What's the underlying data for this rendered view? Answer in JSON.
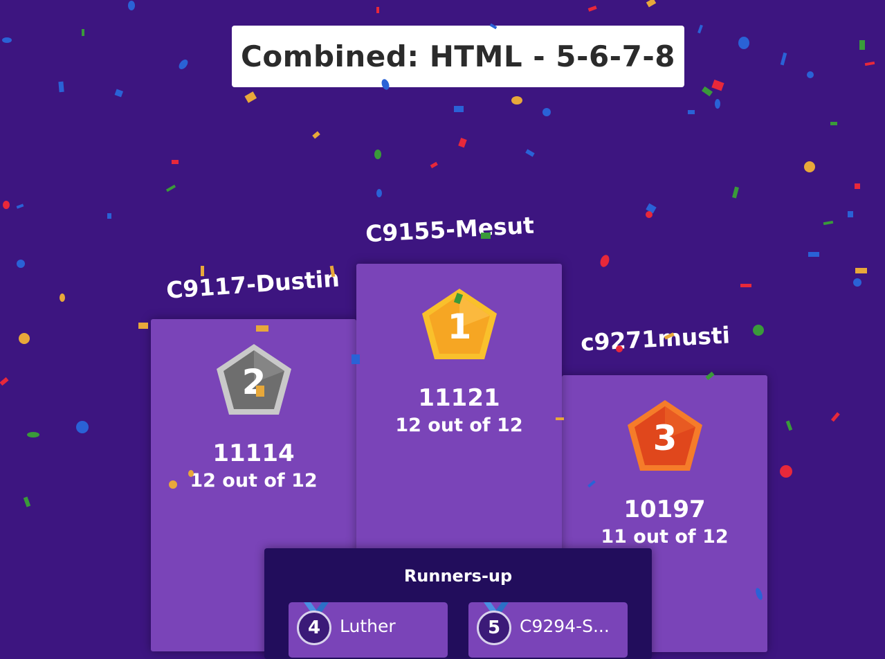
{
  "title": "Combined: HTML - 5-6-7-8",
  "colors": {
    "background": "#3d1580",
    "podium": "#7a44b8",
    "runners_panel": "#220d5c",
    "gold": "#f6a623",
    "silver": "#7a7a7a",
    "bronze": "#e0471c"
  },
  "podium": [
    {
      "place": "1",
      "name": "C9155-Mesut",
      "score": "11121",
      "correct": "12 out of 12",
      "badge_icon": "gold-medal-icon"
    },
    {
      "place": "2",
      "name": "C9117-Dustin",
      "score": "11114",
      "correct": "12 out of 12",
      "badge_icon": "silver-medal-icon"
    },
    {
      "place": "3",
      "name": "c9271musti",
      "score": "10197",
      "correct": "11 out of 12",
      "badge_icon": "bronze-medal-icon"
    }
  ],
  "runners_up": {
    "title": "Runners-up",
    "items": [
      {
        "rank": "4",
        "name": "Luther"
      },
      {
        "rank": "5",
        "name": "C9294-S..."
      }
    ]
  }
}
